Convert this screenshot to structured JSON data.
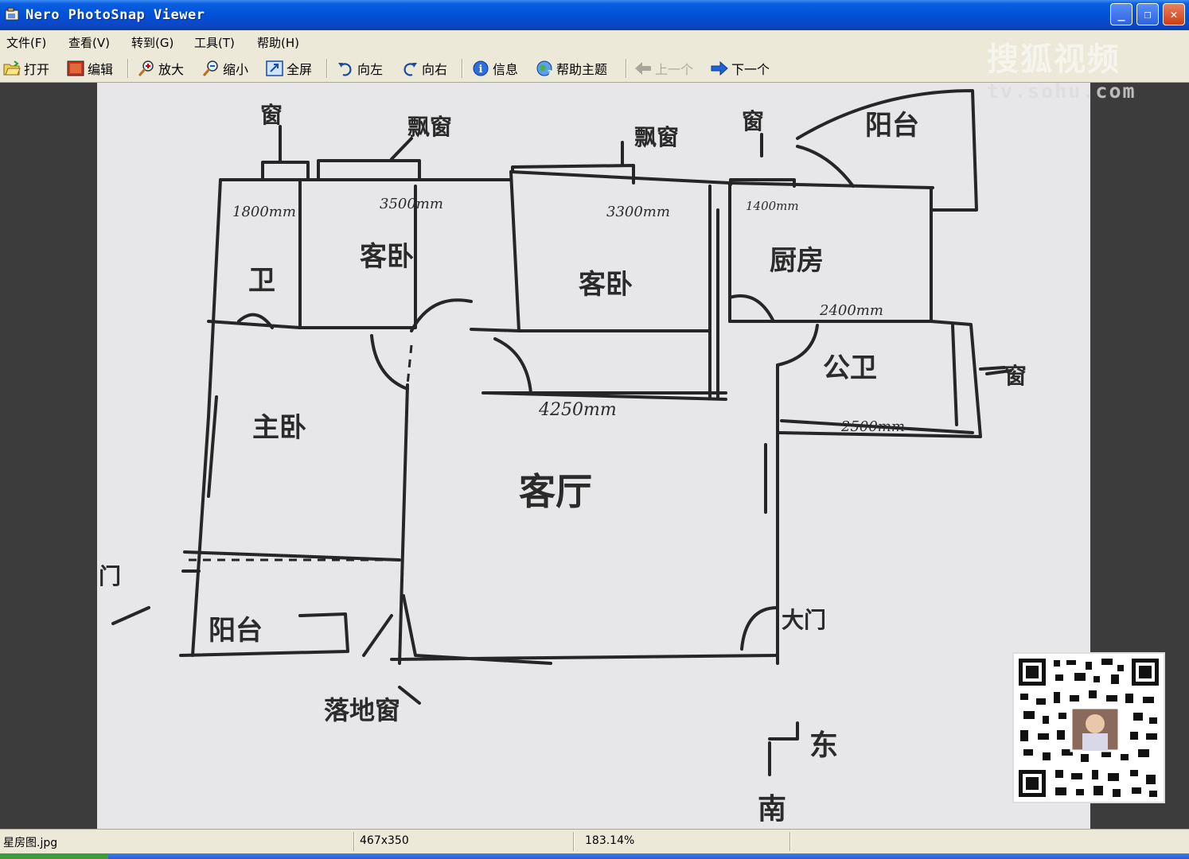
{
  "window": {
    "title": "Nero PhotoSnap Viewer",
    "controls": {
      "minimize": "_",
      "restore": "❐",
      "close": "✕"
    }
  },
  "menu": {
    "items": [
      {
        "label": "文件(F)"
      },
      {
        "label": "查看(V)"
      },
      {
        "label": "转到(G)"
      },
      {
        "label": "工具(T)"
      },
      {
        "label": "帮助(H)"
      }
    ]
  },
  "toolbar": {
    "open": "打开",
    "edit": "编辑",
    "zoom_in": "放大",
    "zoom_out": "缩小",
    "fullscreen": "全屏",
    "rotate_left": "向左",
    "rotate_right": "向右",
    "info": "信息",
    "help_topics": "帮助主题",
    "previous": "上一个",
    "next": "下一个"
  },
  "watermark": {
    "brand": "搜狐视频",
    "url": "tv.sohu.com"
  },
  "floorplan": {
    "rooms": {
      "bath_small": "卫",
      "guest_bedroom": "客卧",
      "bedroom2": "客卧",
      "kitchen": "厨房",
      "balcony_top": "阳台",
      "public_bath": "公卫",
      "master_bedroom": "主卧",
      "living_room": "客厅",
      "balcony_bottom": "阳台"
    },
    "windows": {
      "w1": "窗",
      "w2": "飘窗",
      "w3": "飘窗",
      "w4": "窗",
      "w5": "窗",
      "w6": "落地窗"
    },
    "door_label": "大门",
    "door_left": "门",
    "compass": {
      "east": "东",
      "south": "南"
    },
    "dims": {
      "d1800": "1800mm",
      "d3500": "3500mm",
      "d3300": "3300mm",
      "d1400": "1400mm",
      "d2400": "2400mm",
      "d4250": "4250mm",
      "d2500": "2500mm"
    }
  },
  "statusbar": {
    "filename": "星房图.jpg",
    "dimensions": "467x350",
    "zoom": "183.14%"
  }
}
